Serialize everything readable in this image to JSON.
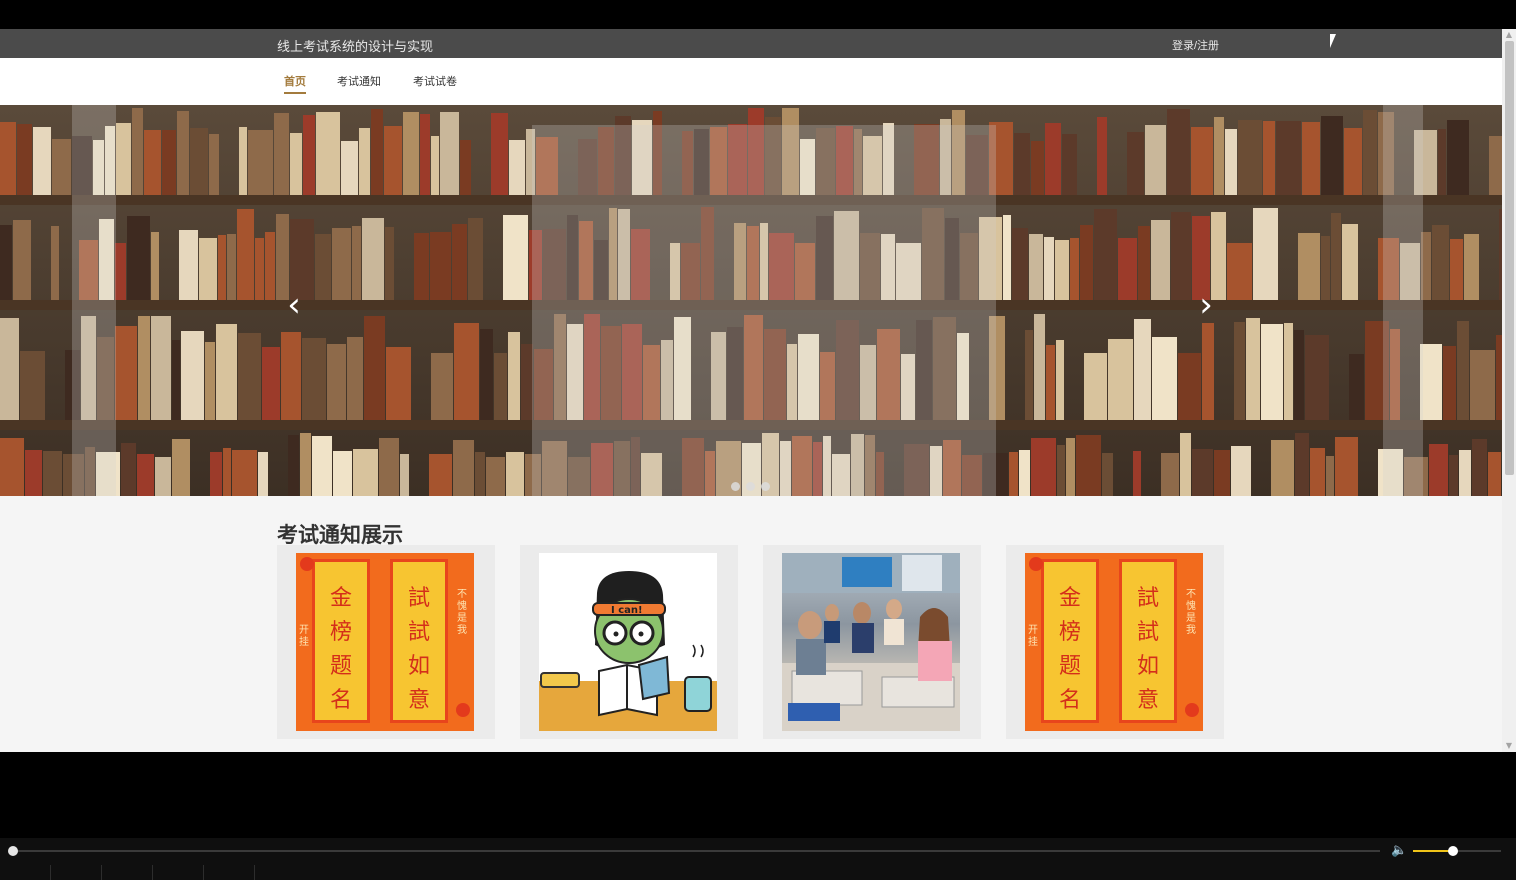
{
  "header": {
    "site_title": "线上考试系统的设计与实现",
    "login_link": "登录/注册"
  },
  "nav": {
    "items": [
      {
        "label": "首页",
        "active": true
      },
      {
        "label": "考试通知",
        "active": false
      },
      {
        "label": "考试试卷",
        "active": false
      }
    ]
  },
  "banner": {
    "prev_icon": "chevron-left-icon",
    "next_icon": "chevron-right-icon",
    "slide_count": 3,
    "active_slide": 1
  },
  "notices": {
    "section_title": "考试通知展示",
    "cards": [
      {
        "image": "poster-jinbang-timing",
        "poster_left": "金榜题名",
        "poster_right": "試試如意",
        "side_left": "开挂",
        "side_right": "不愧是我"
      },
      {
        "image": "cartoon-student-icanstudy",
        "badge": "I can!"
      },
      {
        "image": "classroom-students"
      },
      {
        "image": "poster-jinbang-timing",
        "poster_left": "金榜题名",
        "poster_right": "試試如意",
        "side_left": "开挂",
        "side_right": "不愧是我"
      }
    ]
  },
  "player": {
    "progress": 0,
    "volume": 0.45,
    "colors": {
      "accent": "#f0c419"
    }
  },
  "colors": {
    "topbar": "#4b4b4b",
    "nav_active": "#a37b3d"
  }
}
